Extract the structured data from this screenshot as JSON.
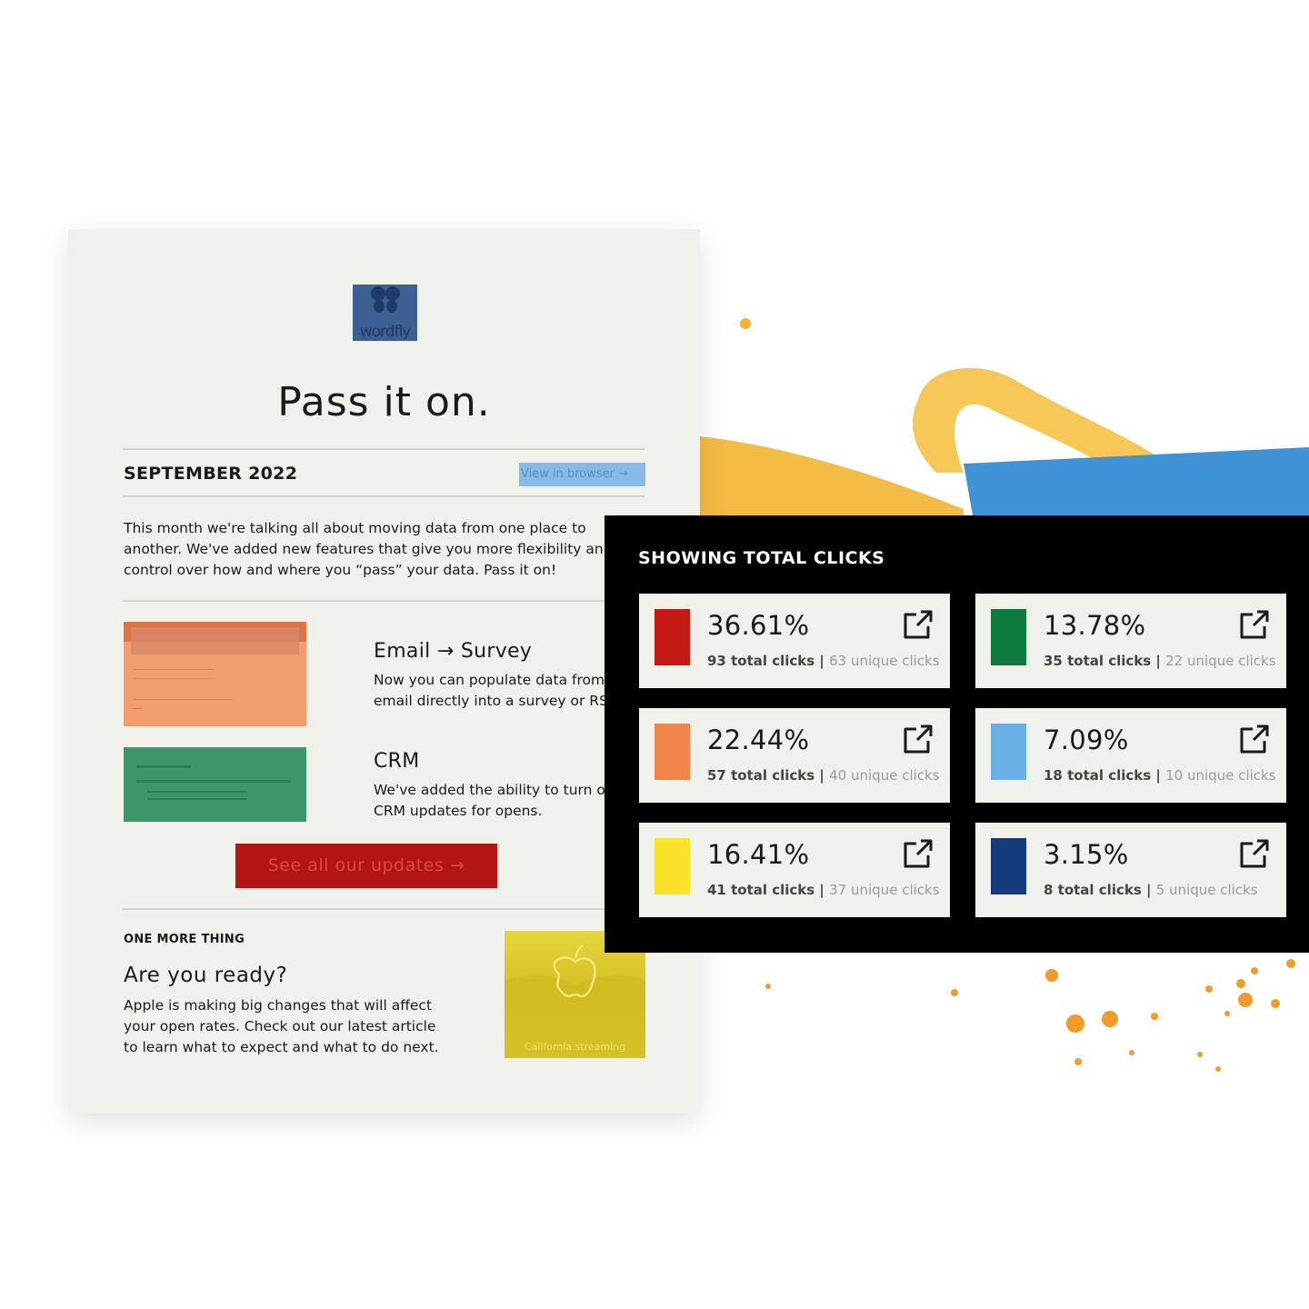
{
  "email": {
    "logo_text": "wordfly",
    "title": "Pass it on.",
    "month": "SEPTEMBER 2022",
    "view_in_browser": "View in browser →",
    "intro_lines": [
      "This month we're talking all about moving data from one place to",
      "another. We've added new features that give you more flexibility an",
      "control over how and where you “pass” your data. Pass it on!"
    ],
    "features": [
      {
        "title": "Email → Survey",
        "lines": [
          "Now you can populate data from",
          "email directly into a survey or RS"
        ]
      },
      {
        "title": "CRM",
        "lines": [
          "We've added the ability to turn o",
          "CRM updates for opens."
        ]
      }
    ],
    "cta": "See all our updates →",
    "one_more_thing": "ONE MORE THING",
    "ready_title": "Are you ready?",
    "ready_lines": [
      "Apple is making big changes that will affect",
      "your open rates. Check out our latest article",
      "to learn what to expect and what to do next."
    ],
    "apple_caption": "California streaming"
  },
  "panel": {
    "title": "SHOWING TOTAL CLICKS",
    "cards": [
      {
        "pct": "36.61%",
        "total": "93 total clicks",
        "unique": "63 unique clicks",
        "color": "#c41a16"
      },
      {
        "pct": "13.78%",
        "total": "35 total clicks",
        "unique": "22 unique clicks",
        "color": "#0f7a3e"
      },
      {
        "pct": "22.44%",
        "total": "57 total clicks",
        "unique": "40 unique clicks",
        "color": "#f0844a"
      },
      {
        "pct": "7.09%",
        "total": "18 total clicks",
        "unique": "10 unique clicks",
        "color": "#6aafe4"
      },
      {
        "pct": "16.41%",
        "total": "41 total clicks",
        "unique": "37 unique clicks",
        "color": "#f9e229"
      },
      {
        "pct": "3.15%",
        "total": "8 total clicks",
        "unique": "5 unique clicks",
        "color": "#133a7a"
      }
    ],
    "icon": "external-link-icon"
  }
}
